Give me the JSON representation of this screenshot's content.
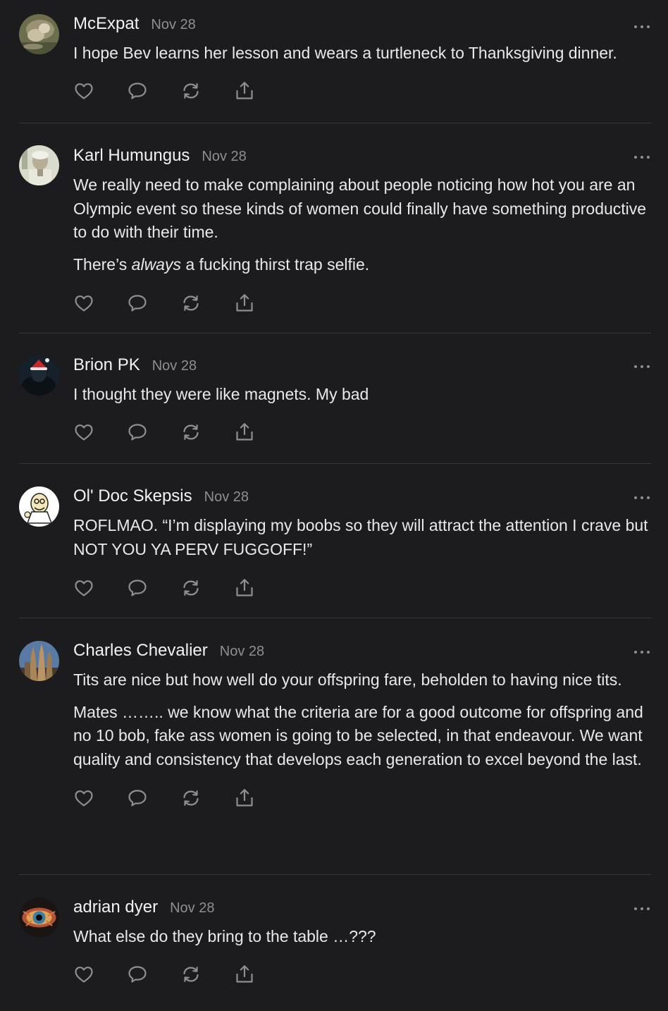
{
  "comments": [
    {
      "author": "McExpat",
      "date": "Nov 28",
      "paragraphs": [
        "I hope Bev learns her lesson and wears a turtleneck to Thanksgiving dinner."
      ]
    },
    {
      "author": "Karl Humungus",
      "date": "Nov 28",
      "paragraphs": [
        "We really need to make complaining about people noticing how hot you are an Olympic event so these kinds of women could finally have something productive to do with their time."
      ],
      "para2": {
        "before": "There’s ",
        "em": "always",
        "after": " a fucking thirst trap selfie."
      }
    },
    {
      "author": "Brion PK",
      "date": "Nov 28",
      "paragraphs": [
        "I thought they were like magnets. My bad"
      ]
    },
    {
      "author": "Ol' Doc Skepsis",
      "date": "Nov 28",
      "paragraphs": [
        "ROFLMAO. “I’m displaying my boobs so they will attract the attention I crave but NOT YOU YA PERV FUGGOFF!”"
      ]
    },
    {
      "author": "Charles Chevalier",
      "date": "Nov 28",
      "paragraphs": [
        "Tits are nice but how well do your offspring fare, beholden to having nice tits.",
        "Mates …….. we know what the criteria are for a good outcome for offspring and no 10 bob, fake ass women is going to be selected, in that endeavour. We want quality and consistency that develops each generation to excel beyond the last."
      ]
    },
    {
      "author": "adrian dyer",
      "date": "Nov 28",
      "paragraphs": [
        "What else do they bring to the table …???"
      ]
    }
  ],
  "icons": {
    "like": "heart-icon",
    "reply": "speech-bubble-icon",
    "restack": "restack-icon",
    "share": "share-icon",
    "more": "more-options-icon"
  },
  "colors": {
    "background": "#1c1c1e",
    "text": "#e9e9eb",
    "muted": "#8e8e93",
    "divider": "#38383b"
  }
}
